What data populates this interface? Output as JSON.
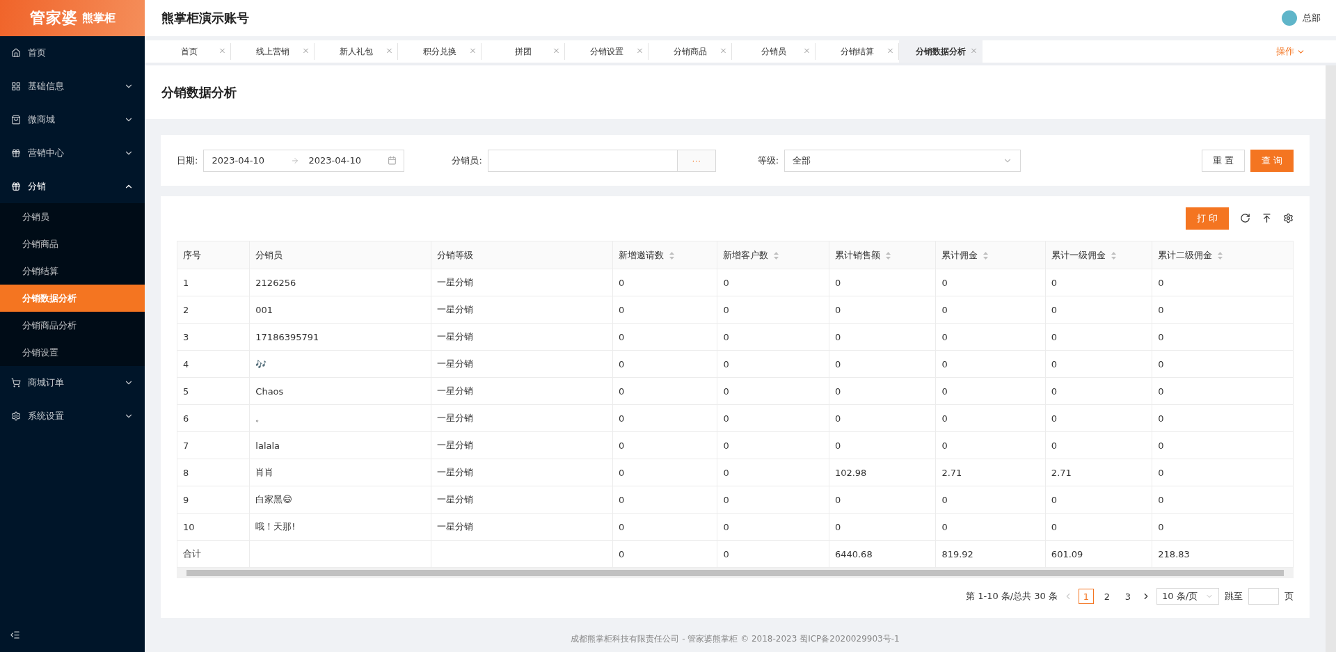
{
  "logo": {
    "brand": "管家婆",
    "product": "熊掌柜"
  },
  "header": {
    "title": "熊掌柜演示账号",
    "user": "总部"
  },
  "sidebar": {
    "items": [
      {
        "label": "首页",
        "expandable": false,
        "expanded": false
      },
      {
        "label": "基础信息",
        "expandable": true,
        "expanded": false
      },
      {
        "label": "微商城",
        "expandable": true,
        "expanded": false
      },
      {
        "label": "营销中心",
        "expandable": true,
        "expanded": false
      },
      {
        "label": "分销",
        "expandable": true,
        "expanded": true,
        "children": [
          {
            "label": "分销员",
            "selected": false
          },
          {
            "label": "分销商品",
            "selected": false
          },
          {
            "label": "分销结算",
            "selected": false
          },
          {
            "label": "分销数据分析",
            "selected": true
          },
          {
            "label": "分销商品分析",
            "selected": false
          },
          {
            "label": "分销设置",
            "selected": false
          }
        ]
      },
      {
        "label": "商城订单",
        "expandable": true,
        "expanded": false
      },
      {
        "label": "系统设置",
        "expandable": true,
        "expanded": false
      }
    ]
  },
  "tabs": [
    {
      "label": "首页",
      "selected": false
    },
    {
      "label": "线上营销",
      "selected": false
    },
    {
      "label": "新人礼包",
      "selected": false
    },
    {
      "label": "积分兑换",
      "selected": false
    },
    {
      "label": "拼团",
      "selected": false
    },
    {
      "label": "分销设置",
      "selected": false
    },
    {
      "label": "分销商品",
      "selected": false
    },
    {
      "label": "分销员",
      "selected": false
    },
    {
      "label": "分销结算",
      "selected": false
    },
    {
      "label": "分销数据分析",
      "selected": true
    }
  ],
  "tab_actions": "操作",
  "page_title": "分销数据分析",
  "filters": {
    "date_label": "日期:",
    "date_start": "2023-04-10",
    "date_end": "2023-04-10",
    "distributor_label": "分销员:",
    "distributor_picker": "···",
    "level_label": "等级:",
    "level_value": "全部",
    "reset": "重 置",
    "search": "查 询"
  },
  "toolbar": {
    "print": "打 印"
  },
  "table": {
    "columns": [
      {
        "label": "序号",
        "sortable": false
      },
      {
        "label": "分销员",
        "sortable": false
      },
      {
        "label": "分销等级",
        "sortable": false
      },
      {
        "label": "新增邀请数",
        "sortable": true
      },
      {
        "label": "新增客户数",
        "sortable": true
      },
      {
        "label": "累计销售额",
        "sortable": true
      },
      {
        "label": "累计佣金",
        "sortable": true
      },
      {
        "label": "累计一级佣金",
        "sortable": true
      },
      {
        "label": "累计二级佣金",
        "sortable": true
      }
    ],
    "rows": [
      [
        "1",
        "2126256",
        "一星分销",
        "0",
        "0",
        "0",
        "0",
        "0",
        "0"
      ],
      [
        "2",
        "001",
        "一星分销",
        "0",
        "0",
        "0",
        "0",
        "0",
        "0"
      ],
      [
        "3",
        "17186395791",
        "一星分销",
        "0",
        "0",
        "0",
        "0",
        "0",
        "0"
      ],
      [
        "4",
        "🎶",
        "一星分销",
        "0",
        "0",
        "0",
        "0",
        "0",
        "0"
      ],
      [
        "5",
        "Chaos",
        "一星分销",
        "0",
        "0",
        "0",
        "0",
        "0",
        "0"
      ],
      [
        "6",
        "。",
        "一星分销",
        "0",
        "0",
        "0",
        "0",
        "0",
        "0"
      ],
      [
        "7",
        "lalala",
        "一星分销",
        "0",
        "0",
        "0",
        "0",
        "0",
        "0"
      ],
      [
        "8",
        "肖肖",
        "一星分销",
        "0",
        "0",
        "102.98",
        "2.71",
        "2.71",
        "0"
      ],
      [
        "9",
        "白家黑😄",
        "一星分销",
        "0",
        "0",
        "0",
        "0",
        "0",
        "0"
      ],
      [
        "10",
        "哦！天那!",
        "一星分销",
        "0",
        "0",
        "0",
        "0",
        "0",
        "0"
      ]
    ],
    "total": {
      "label": "合计",
      "values": [
        "0",
        "0",
        "6440.68",
        "819.92",
        "601.09",
        "218.83"
      ]
    }
  },
  "pagination": {
    "summary": "第 1-10 条/总共 30 条",
    "pages": [
      {
        "label": "1",
        "selected": true
      },
      {
        "label": "2",
        "selected": false
      },
      {
        "label": "3",
        "selected": false
      }
    ],
    "page_size": "10 条/页",
    "jump_label": "跳至",
    "jump_suffix": "页"
  },
  "footer": "成都熊掌柜科技有限责任公司 - 管家婆熊掌柜 © 2018-2023 蜀ICP备2020029903号-1"
}
